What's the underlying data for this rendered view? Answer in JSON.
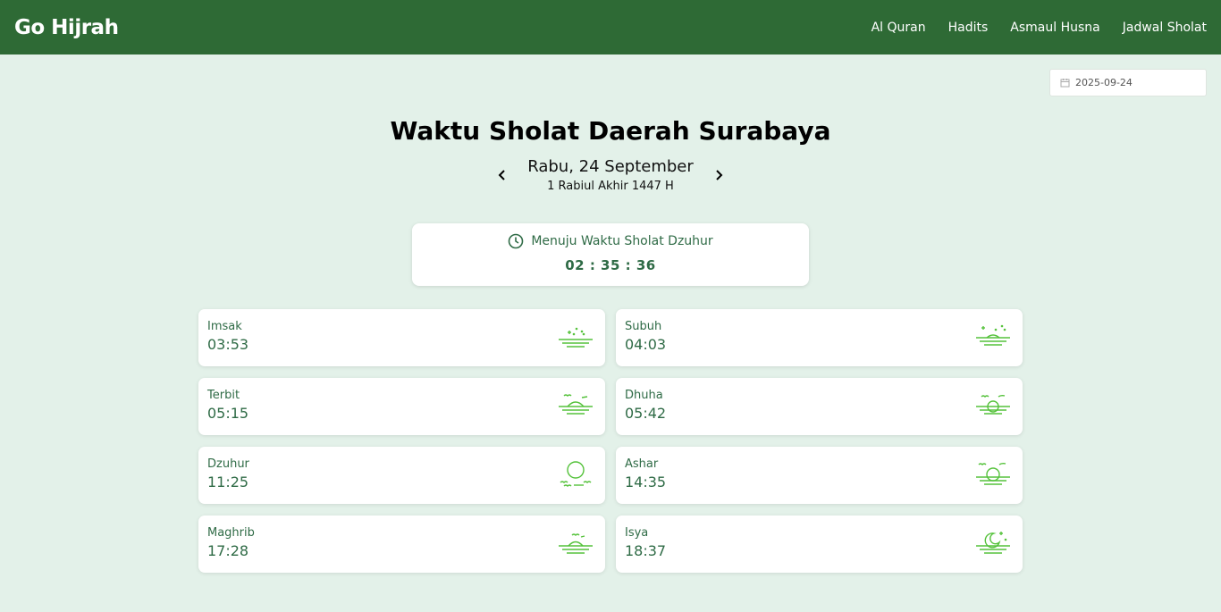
{
  "brand": "Go Hijrah",
  "nav": [
    "Al Quran",
    "Hadits",
    "Asmaul Husna",
    "Jadwal Sholat"
  ],
  "date_input": {
    "value": "2025-09-24",
    "icon": "calendar-icon"
  },
  "title": "Waktu Sholat Daerah Surabaya",
  "date_gregorian": "Rabu, 24 September",
  "date_hijri": "1 Rabiul Akhir 1447 H",
  "countdown": {
    "label": "Menuju Waktu Sholat Dzuhur",
    "time": "02 : 35 : 36",
    "icon": "clock-icon"
  },
  "prayers": [
    {
      "name": "Imsak",
      "time": "03:53",
      "icon": "imsak-icon"
    },
    {
      "name": "Subuh",
      "time": "04:03",
      "icon": "subuh-icon"
    },
    {
      "name": "Terbit",
      "time": "05:15",
      "icon": "sunrise-icon"
    },
    {
      "name": "Dhuha",
      "time": "05:42",
      "icon": "dhuha-icon"
    },
    {
      "name": "Dzuhur",
      "time": "11:25",
      "icon": "sun-icon"
    },
    {
      "name": "Ashar",
      "time": "14:35",
      "icon": "ashar-icon"
    },
    {
      "name": "Maghrib",
      "time": "17:28",
      "icon": "sunset-icon"
    },
    {
      "name": "Isya",
      "time": "18:37",
      "icon": "moon-icon"
    }
  ],
  "colors": {
    "navbar": "#2e6a35",
    "background": "#e3f1e9",
    "accent": "#2f6b46",
    "icon_green": "#55c23b"
  }
}
